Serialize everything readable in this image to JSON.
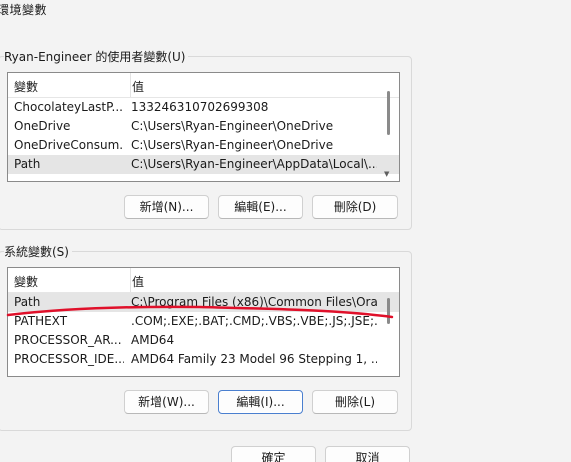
{
  "window": {
    "title": "環境變數"
  },
  "user_vars": {
    "group_label": "Ryan-Engineer 的使用者變數(U)",
    "columns": [
      "變數",
      "值"
    ],
    "rows": [
      {
        "name": "ChocolateyLastP...",
        "value": "133246310702699308"
      },
      {
        "name": "OneDrive",
        "value": "C:\\Users\\Ryan-Engineer\\OneDrive"
      },
      {
        "name": "OneDriveConsum...",
        "value": "C:\\Users\\Ryan-Engineer\\OneDrive"
      },
      {
        "name": "Path",
        "value": "C:\\Users\\Ryan-Engineer\\AppData\\Local\\..."
      }
    ],
    "buttons": {
      "new": "新增(N)...",
      "edit": "編輯(E)...",
      "delete": "刪除(D)"
    }
  },
  "system_vars": {
    "group_label": "系統變數(S)",
    "columns": [
      "變數",
      "值"
    ],
    "rows": [
      {
        "name": "Path",
        "value": "C:\\Program Files (x86)\\Common Files\\Ora..."
      },
      {
        "name": "PATHEXT",
        "value": ".COM;.EXE;.BAT;.CMD;.VBS;.VBE;.JS;.JSE;..."
      },
      {
        "name": "PROCESSOR_AR...",
        "value": "AMD64"
      },
      {
        "name": "PROCESSOR_IDE...",
        "value": "AMD64 Family 23 Model 96 Stepping 1, ..."
      }
    ],
    "buttons": {
      "new": "新增(W)...",
      "edit": "編輯(I)...",
      "delete": "刪除(L)"
    }
  },
  "dialog_buttons": {
    "ok": "確定",
    "cancel": "取消"
  },
  "annotation": {
    "color": "#e0102a"
  }
}
